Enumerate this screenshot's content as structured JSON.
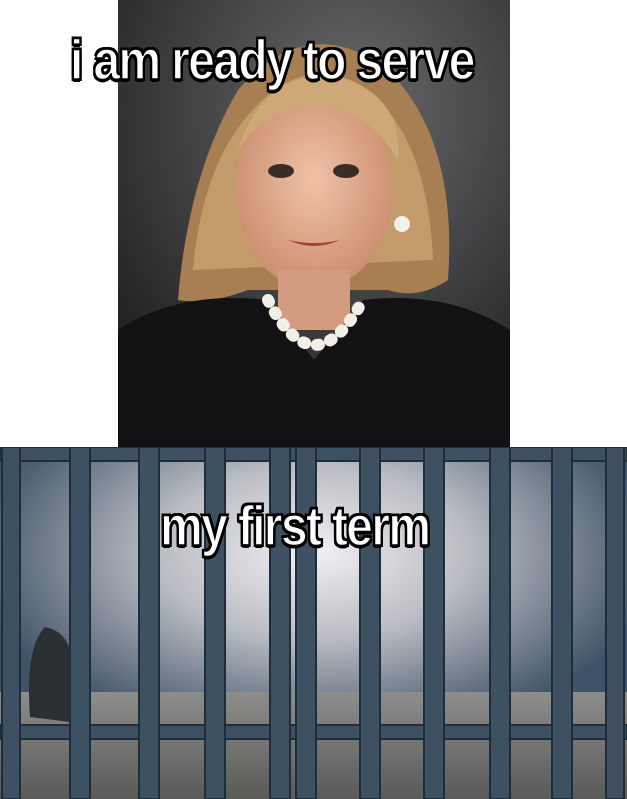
{
  "captions": {
    "top": "i am ready to serve",
    "bottom": "my first term"
  },
  "images": {
    "top": "portrait-photo",
    "bottom": "jail-cell-photo"
  },
  "colors": {
    "caption_fill": "#ffffff",
    "caption_outline": "#000000",
    "jacket": "#111111",
    "hair": "#b89162",
    "bars": "#3e5162"
  }
}
